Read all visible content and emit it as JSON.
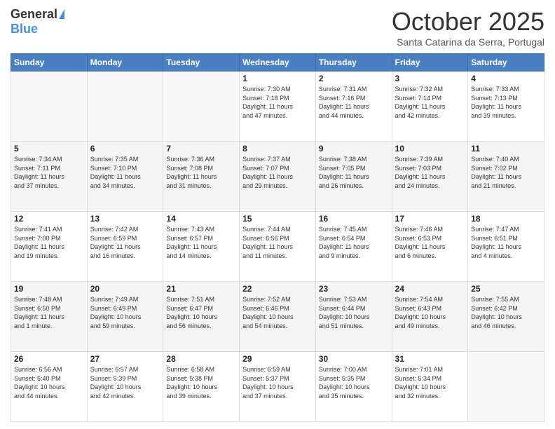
{
  "logo": {
    "general": "General",
    "blue": "Blue"
  },
  "header": {
    "month": "October 2025",
    "location": "Santa Catarina da Serra, Portugal"
  },
  "days_of_week": [
    "Sunday",
    "Monday",
    "Tuesday",
    "Wednesday",
    "Thursday",
    "Friday",
    "Saturday"
  ],
  "weeks": [
    [
      {
        "day": "",
        "info": ""
      },
      {
        "day": "",
        "info": ""
      },
      {
        "day": "",
        "info": ""
      },
      {
        "day": "1",
        "info": "Sunrise: 7:30 AM\nSunset: 7:18 PM\nDaylight: 11 hours\nand 47 minutes."
      },
      {
        "day": "2",
        "info": "Sunrise: 7:31 AM\nSunset: 7:16 PM\nDaylight: 11 hours\nand 44 minutes."
      },
      {
        "day": "3",
        "info": "Sunrise: 7:32 AM\nSunset: 7:14 PM\nDaylight: 11 hours\nand 42 minutes."
      },
      {
        "day": "4",
        "info": "Sunrise: 7:33 AM\nSunset: 7:13 PM\nDaylight: 11 hours\nand 39 minutes."
      }
    ],
    [
      {
        "day": "5",
        "info": "Sunrise: 7:34 AM\nSunset: 7:11 PM\nDaylight: 11 hours\nand 37 minutes."
      },
      {
        "day": "6",
        "info": "Sunrise: 7:35 AM\nSunset: 7:10 PM\nDaylight: 11 hours\nand 34 minutes."
      },
      {
        "day": "7",
        "info": "Sunrise: 7:36 AM\nSunset: 7:08 PM\nDaylight: 11 hours\nand 31 minutes."
      },
      {
        "day": "8",
        "info": "Sunrise: 7:37 AM\nSunset: 7:07 PM\nDaylight: 11 hours\nand 29 minutes."
      },
      {
        "day": "9",
        "info": "Sunrise: 7:38 AM\nSunset: 7:05 PM\nDaylight: 11 hours\nand 26 minutes."
      },
      {
        "day": "10",
        "info": "Sunrise: 7:39 AM\nSunset: 7:03 PM\nDaylight: 11 hours\nand 24 minutes."
      },
      {
        "day": "11",
        "info": "Sunrise: 7:40 AM\nSunset: 7:02 PM\nDaylight: 11 hours\nand 21 minutes."
      }
    ],
    [
      {
        "day": "12",
        "info": "Sunrise: 7:41 AM\nSunset: 7:00 PM\nDaylight: 11 hours\nand 19 minutes."
      },
      {
        "day": "13",
        "info": "Sunrise: 7:42 AM\nSunset: 6:59 PM\nDaylight: 11 hours\nand 16 minutes."
      },
      {
        "day": "14",
        "info": "Sunrise: 7:43 AM\nSunset: 6:57 PM\nDaylight: 11 hours\nand 14 minutes."
      },
      {
        "day": "15",
        "info": "Sunrise: 7:44 AM\nSunset: 6:56 PM\nDaylight: 11 hours\nand 11 minutes."
      },
      {
        "day": "16",
        "info": "Sunrise: 7:45 AM\nSunset: 6:54 PM\nDaylight: 11 hours\nand 9 minutes."
      },
      {
        "day": "17",
        "info": "Sunrise: 7:46 AM\nSunset: 6:53 PM\nDaylight: 11 hours\nand 6 minutes."
      },
      {
        "day": "18",
        "info": "Sunrise: 7:47 AM\nSunset: 6:51 PM\nDaylight: 11 hours\nand 4 minutes."
      }
    ],
    [
      {
        "day": "19",
        "info": "Sunrise: 7:48 AM\nSunset: 6:50 PM\nDaylight: 11 hours\nand 1 minute."
      },
      {
        "day": "20",
        "info": "Sunrise: 7:49 AM\nSunset: 6:49 PM\nDaylight: 10 hours\nand 59 minutes."
      },
      {
        "day": "21",
        "info": "Sunrise: 7:51 AM\nSunset: 6:47 PM\nDaylight: 10 hours\nand 56 minutes."
      },
      {
        "day": "22",
        "info": "Sunrise: 7:52 AM\nSunset: 6:46 PM\nDaylight: 10 hours\nand 54 minutes."
      },
      {
        "day": "23",
        "info": "Sunrise: 7:53 AM\nSunset: 6:44 PM\nDaylight: 10 hours\nand 51 minutes."
      },
      {
        "day": "24",
        "info": "Sunrise: 7:54 AM\nSunset: 6:43 PM\nDaylight: 10 hours\nand 49 minutes."
      },
      {
        "day": "25",
        "info": "Sunrise: 7:55 AM\nSunset: 6:42 PM\nDaylight: 10 hours\nand 46 minutes."
      }
    ],
    [
      {
        "day": "26",
        "info": "Sunrise: 6:56 AM\nSunset: 5:40 PM\nDaylight: 10 hours\nand 44 minutes."
      },
      {
        "day": "27",
        "info": "Sunrise: 6:57 AM\nSunset: 5:39 PM\nDaylight: 10 hours\nand 42 minutes."
      },
      {
        "day": "28",
        "info": "Sunrise: 6:58 AM\nSunset: 5:38 PM\nDaylight: 10 hours\nand 39 minutes."
      },
      {
        "day": "29",
        "info": "Sunrise: 6:59 AM\nSunset: 5:37 PM\nDaylight: 10 hours\nand 37 minutes."
      },
      {
        "day": "30",
        "info": "Sunrise: 7:00 AM\nSunset: 5:35 PM\nDaylight: 10 hours\nand 35 minutes."
      },
      {
        "day": "31",
        "info": "Sunrise: 7:01 AM\nSunset: 5:34 PM\nDaylight: 10 hours\nand 32 minutes."
      },
      {
        "day": "",
        "info": ""
      }
    ]
  ]
}
